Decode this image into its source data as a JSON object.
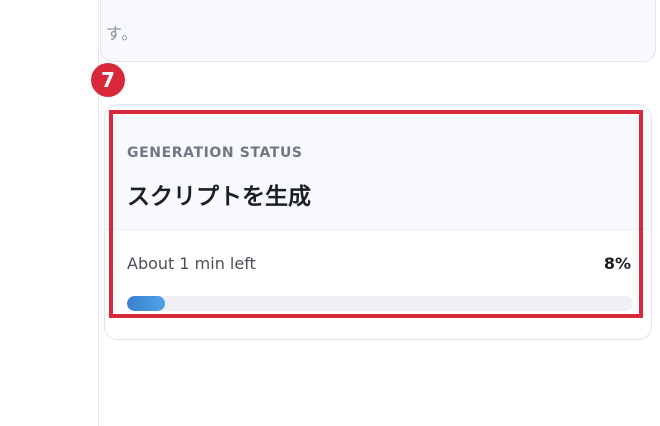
{
  "top_card": {
    "text": "す。"
  },
  "annotation": {
    "step_number": "7",
    "highlight_color": "#d9283a"
  },
  "generation": {
    "eyebrow": "GENERATION STATUS",
    "title": "スクリプトを生成",
    "time_left": "About 1 min left",
    "percent_label": "8%",
    "progress_fraction": 0.08,
    "progress_color": "#3a7fcf"
  }
}
